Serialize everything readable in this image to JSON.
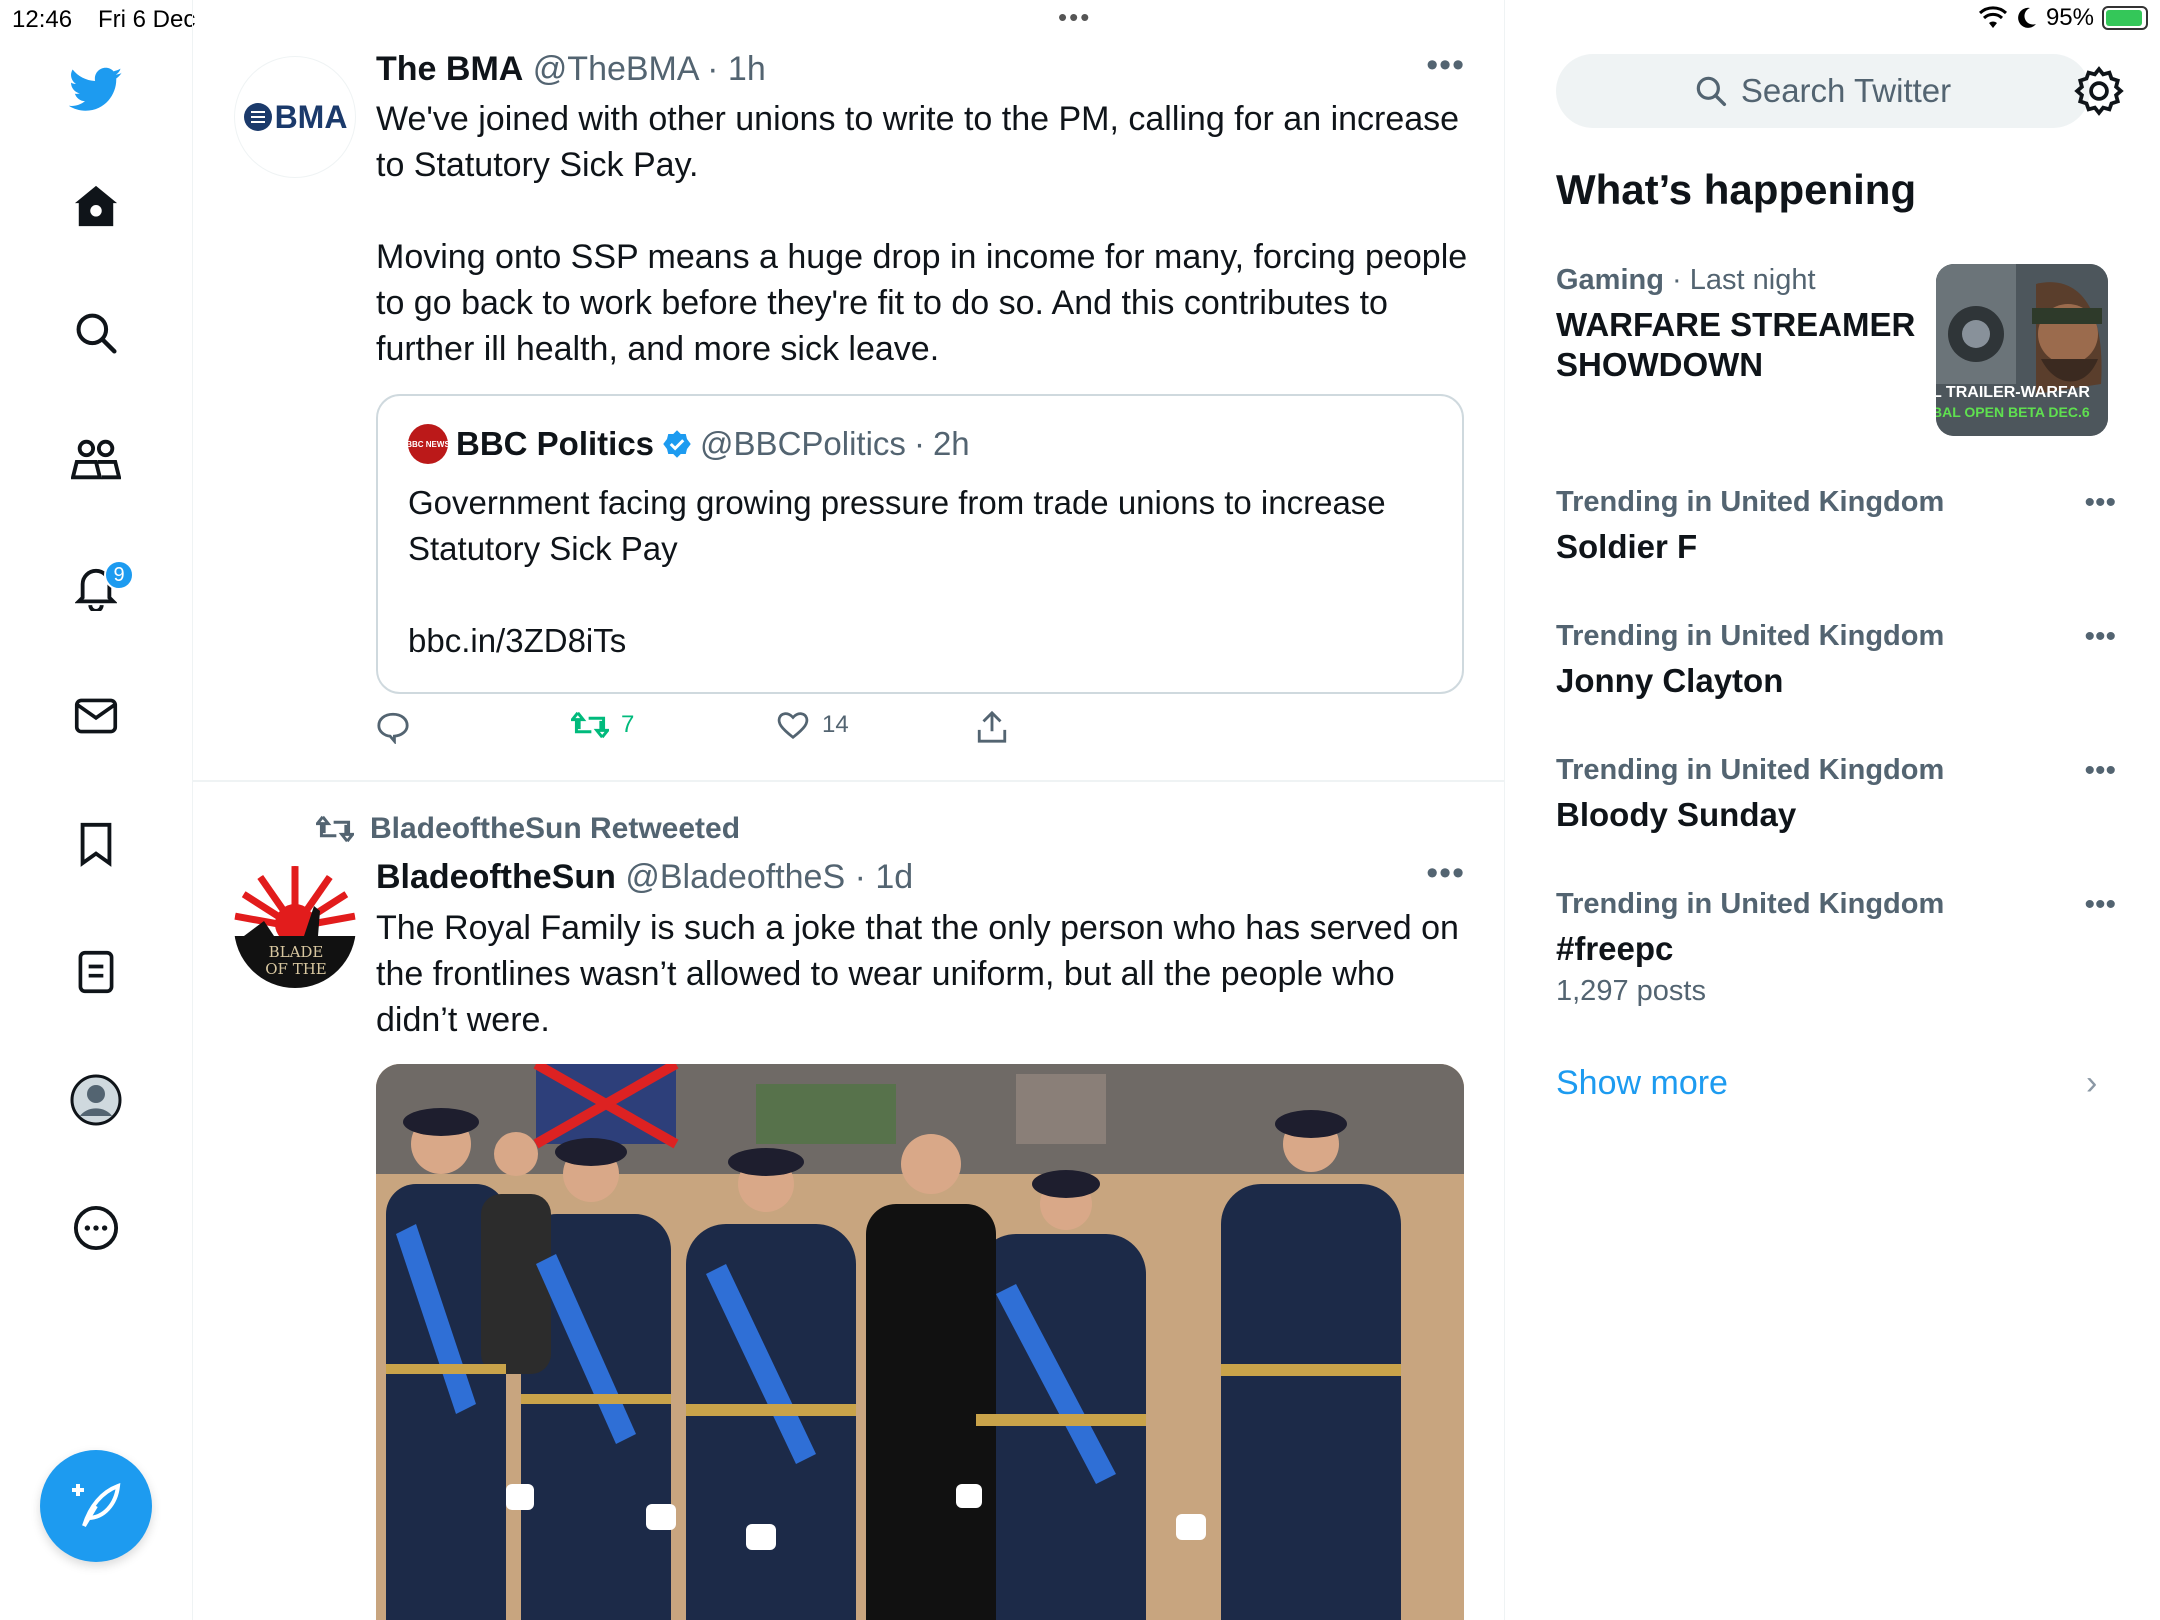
{
  "status_bar": {
    "time": "12:46",
    "date": "Fri 6 Dec",
    "battery": "95%",
    "battery_level": 0.95
  },
  "nav": {
    "notification_count": "9",
    "items": [
      "twitter-logo-icon",
      "home-icon",
      "search-icon",
      "communities-icon",
      "notifications-icon",
      "messages-icon",
      "bookmarks-icon",
      "lists-icon",
      "profile-icon",
      "more-icon"
    ]
  },
  "timeline": {
    "tweet1": {
      "avatar_text": "BMA",
      "name": "The BMA",
      "handle": "@TheBMA",
      "time": "1h",
      "text": "We've joined with other unions to write to the PM, calling for an increase to Statutory Sick Pay.\n\nMoving onto SSP means a huge drop in income for many, forcing people to go back to work before they're fit to do so. And this contributes to further ill health, and more sick leave.",
      "quote": {
        "logo_text": "BBC NEWS",
        "name": "BBC Politics",
        "handle": "@BBCPolitics",
        "time": "2h",
        "text": "Government facing growing pressure from trade unions to increase Statutory Sick Pay\n\nbbc.in/3ZD8iTs"
      },
      "retweets": "7",
      "likes": "14"
    },
    "tweet2": {
      "retweeted_by": "BladeoftheSun Retweeted",
      "avatar_text": "BLADE OF THE",
      "name": "BladeoftheSun",
      "handle": "@BladeoftheS",
      "time": "1d",
      "text": "The Royal Family is such a joke that the only person who has served on the frontlines wasn’t allowed to wear uniform, but all the people who didn’t were."
    }
  },
  "sidebar": {
    "search_placeholder": "Search Twitter",
    "title": "What’s happening",
    "featured": {
      "category": "Gaming",
      "time": "Last night",
      "name": "WARFARE STREAMER SHOWDOWN",
      "thumb_line1": "L TRAILER-WARFAR",
      "thumb_line2": "BAL OPEN BETA DEC.6"
    },
    "trends": [
      {
        "category": "Trending in United Kingdom",
        "name": "Soldier F",
        "count": ""
      },
      {
        "category": "Trending in United Kingdom",
        "name": "Jonny Clayton",
        "count": ""
      },
      {
        "category": "Trending in United Kingdom",
        "name": "Bloody Sunday",
        "count": ""
      },
      {
        "category": "Trending in United Kingdom",
        "name": "#freepc",
        "count": "1,297 posts"
      }
    ],
    "show_more": "Show more"
  },
  "colors": {
    "accent": "#1d9bf0",
    "text": "#0f1419",
    "muted": "#536471",
    "retweet_green": "#00ba7c"
  }
}
